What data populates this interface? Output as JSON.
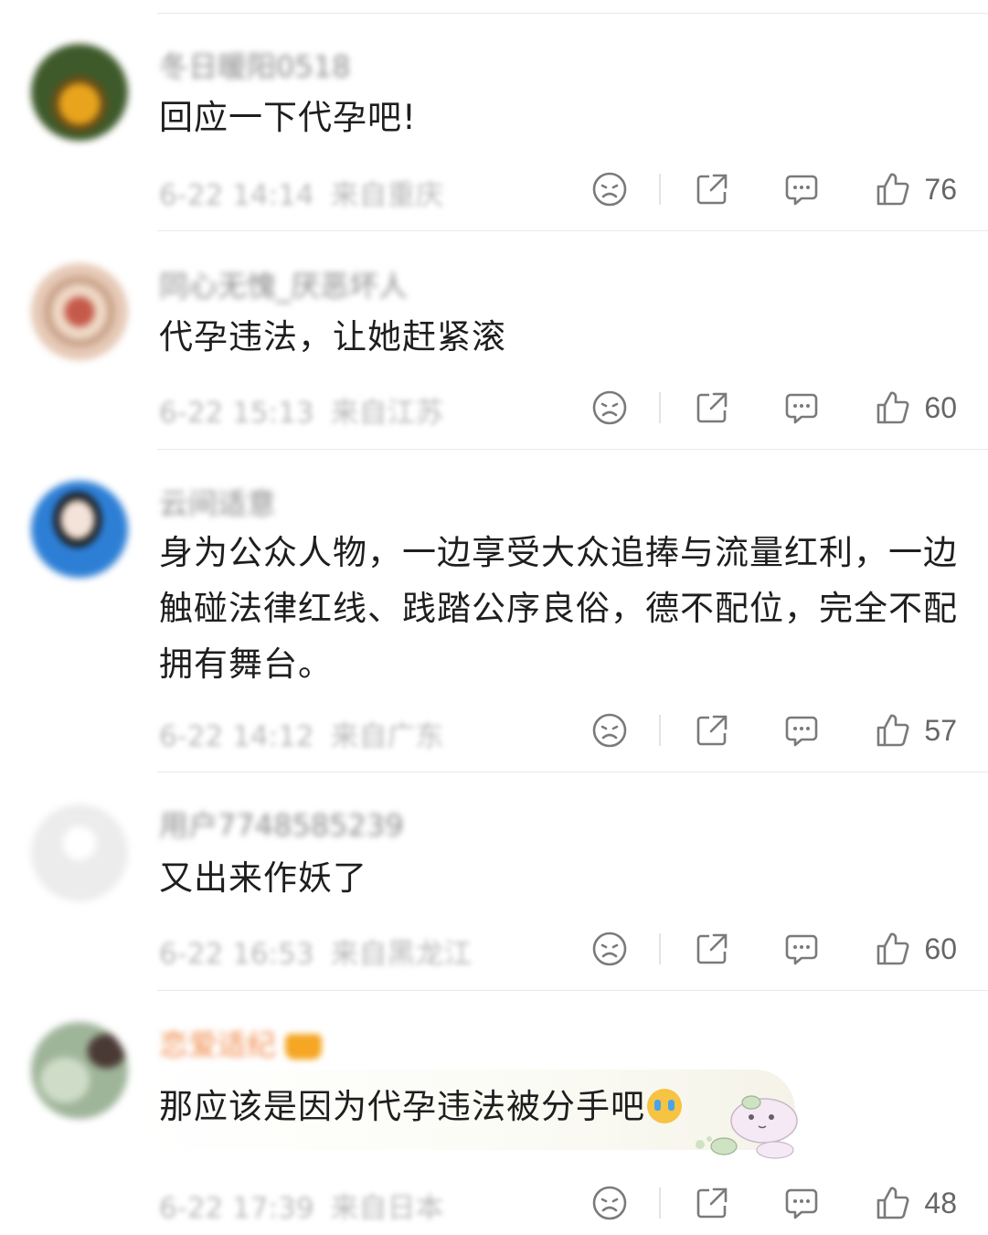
{
  "comments": [
    {
      "username": "冬日暖阳0518",
      "text": "回应一下代孕吧!",
      "date": "6-22 14:14",
      "location": "来自重庆",
      "likes": "76",
      "avatar_color": "#3e5a2a",
      "avatar_accent": "#e8a41c"
    },
    {
      "username": "同心无愧_厌恶坏人",
      "text": "代孕违法，让她赶紧滚",
      "date": "6-22 15:13",
      "location": "来自江苏",
      "likes": "60",
      "avatar_color": "#e6c9b6",
      "avatar_accent": "#c55a4b"
    },
    {
      "username": "云间适意",
      "text": "身为公众人物，一边享受大众追捧与流量红利，一边触碰法律红线、践踏公序良俗，德不配位，完全不配拥有舞台。",
      "date": "6-22 14:12",
      "location": "来自广东",
      "likes": "57",
      "avatar_color": "#2d7fd6",
      "avatar_accent": "#f3e3d8"
    },
    {
      "username": "用户7748585239",
      "text": "又出来作妖了",
      "date": "6-22 16:53",
      "location": "来自黑龙江",
      "likes": "60",
      "avatar_color": "#ececec",
      "avatar_accent": "#ffffff"
    },
    {
      "username": "恋爱适纪",
      "text": "那应该是因为代孕违法被分手吧",
      "date": "6-22 17:39",
      "location": "来自日本",
      "likes": "48",
      "avatar_color": "#9fb59a",
      "avatar_accent": "#4a3a35"
    }
  ],
  "colors": {
    "divider": "#e9e9e9",
    "icon": "#7a7a7a",
    "vip_name": "#f08a4b"
  },
  "icons": [
    "dislike-face-icon",
    "share-icon",
    "comment-icon",
    "like-icon",
    "crown-badge-icon",
    "crying-emoji-icon",
    "sticker-decoration"
  ]
}
